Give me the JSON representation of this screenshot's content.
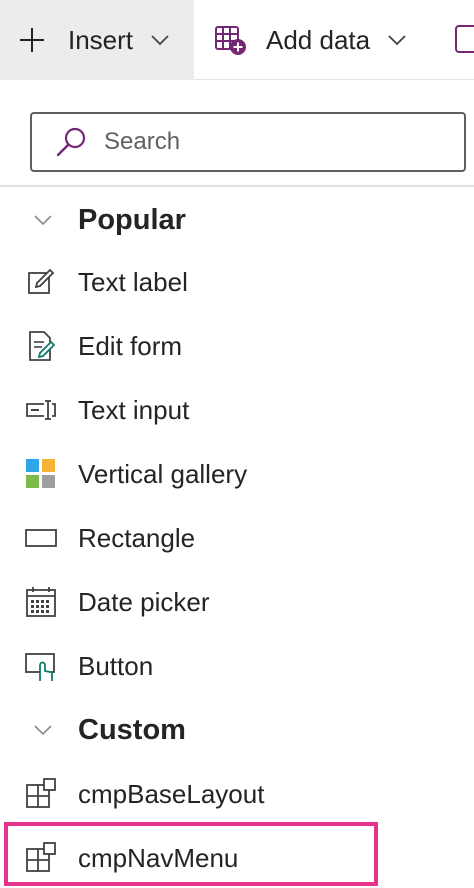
{
  "toolbar": {
    "insert_label": "Insert",
    "add_data_label": "Add data"
  },
  "search": {
    "placeholder": "Search",
    "value": ""
  },
  "sections": [
    {
      "title": "Popular",
      "items": [
        {
          "label": "Text label",
          "icon": "text-label-icon"
        },
        {
          "label": "Edit form",
          "icon": "edit-form-icon"
        },
        {
          "label": "Text input",
          "icon": "text-input-icon"
        },
        {
          "label": "Vertical gallery",
          "icon": "vertical-gallery-icon"
        },
        {
          "label": "Rectangle",
          "icon": "rectangle-icon"
        },
        {
          "label": "Date picker",
          "icon": "date-picker-icon"
        },
        {
          "label": "Button",
          "icon": "button-icon"
        }
      ]
    },
    {
      "title": "Custom",
      "items": [
        {
          "label": "cmpBaseLayout",
          "icon": "component-icon"
        },
        {
          "label": "cmpNavMenu",
          "icon": "component-icon",
          "highlighted": true
        }
      ]
    }
  ],
  "colors": {
    "highlight_border": "#e6338b",
    "accent_purple": "#742774",
    "accent_teal": "#0f7b6c"
  }
}
